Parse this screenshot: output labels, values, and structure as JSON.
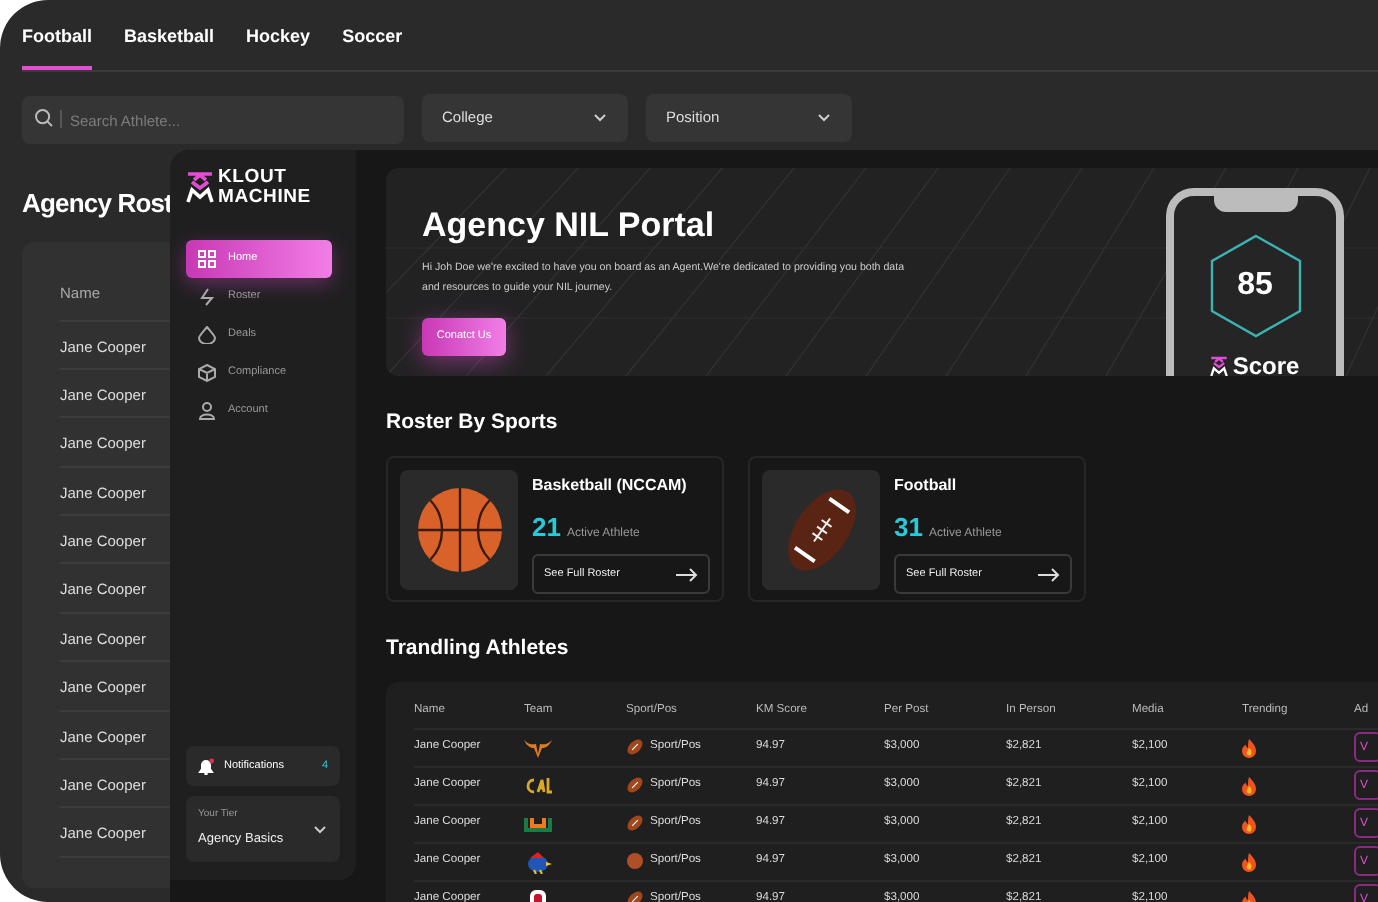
{
  "tabs": [
    {
      "label": "Football",
      "selected": true
    },
    {
      "label": "Basketball",
      "selected": false
    },
    {
      "label": "Hockey",
      "selected": false
    },
    {
      "label": "Soccer",
      "selected": false
    }
  ],
  "search": {
    "placeholder": "Search Athlete..."
  },
  "filters": [
    {
      "label": "College"
    },
    {
      "label": "Position"
    }
  ],
  "roster_panel": {
    "title": "Agency Rost",
    "column": "Name",
    "rows": [
      "Jane Cooper",
      "Jane Cooper",
      "Jane Cooper",
      "Jane Cooper",
      "Jane Cooper",
      "Jane Cooper",
      "Jane Cooper",
      "Jane Cooper",
      "Jane Cooper",
      "Jane Cooper",
      "Jane Cooper"
    ]
  },
  "portal": {
    "logo": {
      "line_1": "KLOUT",
      "line_2": "MACHINE"
    },
    "sidebar": {
      "items": [
        {
          "label": "Home",
          "kind": "grid",
          "selected": true
        },
        {
          "label": "Roster",
          "kind": "bolt",
          "selected": false
        },
        {
          "label": "Deals",
          "kind": "drop",
          "selected": false
        },
        {
          "label": "Compliance",
          "kind": "cube",
          "selected": false
        },
        {
          "label": "Account",
          "kind": "person",
          "selected": false
        }
      ],
      "notifications": {
        "label": "Notifications",
        "count": "4"
      },
      "tier": {
        "label": "Your Tier",
        "value": "Agency Basics"
      }
    },
    "hero": {
      "title": "Agency NIL Portal",
      "text": "Hi Joh Doe we're excited to have you on board as an Agent.We're dedicated to providing you both data and resources to guide your NIL journey.",
      "button": "Conatct Us",
      "score": {
        "value": "85",
        "label": "Score"
      }
    },
    "roster_by_sports": {
      "title": "Roster By Sports",
      "cards": [
        {
          "kind": "basketball",
          "sport": "Basketball (NCCAM)",
          "count": "21",
          "count_label": "Active Athlete",
          "button": "See Full Roster"
        },
        {
          "kind": "football",
          "sport": "Football",
          "count": "31",
          "count_label": "Active Athlete",
          "button": "See Full Roster"
        }
      ]
    },
    "trending": {
      "title": "Trandling Athletes",
      "columns": [
        "Name",
        "Team",
        "Sport/Pos",
        "KM Score",
        "Per Post",
        "In Person",
        "Media",
        "Trending",
        "Ad"
      ],
      "rows": [
        {
          "name": "Jane Cooper",
          "team": {
            "kind": "horns"
          },
          "sport": {
            "kind": "football",
            "label": "Sport/Pos"
          },
          "km_score": "94.97",
          "per_post": "$3,000",
          "in_person": "$2,821",
          "media": "$2,100",
          "action": "V"
        },
        {
          "name": "Jane Cooper",
          "team": {
            "kind": "script"
          },
          "sport": {
            "kind": "football",
            "label": "Sport/Pos"
          },
          "km_score": "94.97",
          "per_post": "$3,000",
          "in_person": "$2,821",
          "media": "$2,100",
          "action": "V"
        },
        {
          "name": "Jane Cooper",
          "team": {
            "kind": "u"
          },
          "sport": {
            "kind": "football",
            "label": "Sport/Pos"
          },
          "km_score": "94.97",
          "per_post": "$3,000",
          "in_person": "$2,821",
          "media": "$2,100",
          "action": "V"
        },
        {
          "name": "Jane Cooper",
          "team": {
            "kind": "bird"
          },
          "sport": {
            "kind": "basketball",
            "label": "Sport/Pos"
          },
          "km_score": "94.97",
          "per_post": "$3,000",
          "in_person": "$2,821",
          "media": "$2,100",
          "action": "V"
        },
        {
          "name": "Jane Cooper",
          "team": {
            "kind": "o"
          },
          "sport": {
            "kind": "football",
            "label": "Sport/Pos"
          },
          "km_score": "94.97",
          "per_post": "$3,000",
          "in_person": "$2,821",
          "media": "$2,100",
          "action": "V"
        }
      ]
    }
  }
}
